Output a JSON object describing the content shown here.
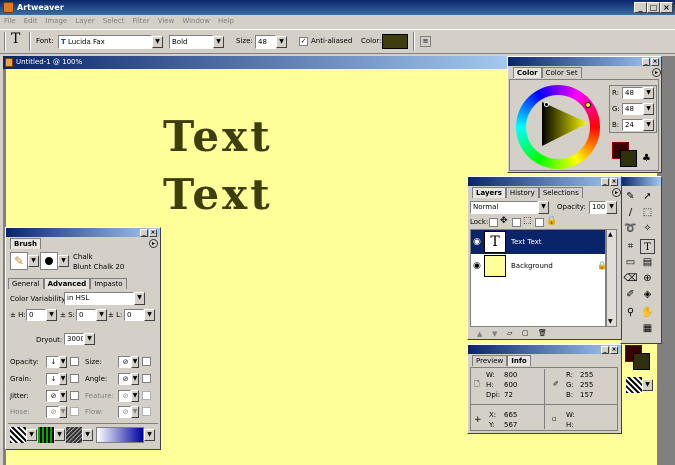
{
  "app": {
    "title": "Artweaver"
  },
  "menu": [
    "File",
    "Edit",
    "Image",
    "Layer",
    "Select",
    "Filter",
    "View",
    "Window",
    "Help"
  ],
  "toolbar": {
    "tool_glyph": "T",
    "font_label": "Font:",
    "font_value": "Lucida Fax",
    "style_value": "Bold",
    "size_label": "Size:",
    "size_value": "48",
    "antialias_label": "Anti-aliased",
    "antialias_checked": true,
    "color_label": "Color:",
    "color_value": "#3d3d0d"
  },
  "document": {
    "title": "Untitled-1 @ 100%",
    "lines": [
      "Text",
      "Text"
    ],
    "background": "#ffff99"
  },
  "color_panel": {
    "tabs": [
      "Color",
      "Color Set"
    ],
    "r_label": "R:",
    "r": "48",
    "g_label": "G:",
    "g": "48",
    "b_label": "B:",
    "b": "24"
  },
  "layers_panel": {
    "tabs": [
      "Layers",
      "History",
      "Selections"
    ],
    "mode": "Normal",
    "opacity_label": "Opacity:",
    "opacity": "100",
    "lock_label": "Lock:",
    "layers": [
      {
        "name": "Text Text",
        "thumb": "T",
        "selected": true
      },
      {
        "name": "Background",
        "thumb": "",
        "selected": false
      }
    ]
  },
  "info_panel": {
    "tabs": [
      "Preview",
      "Info"
    ],
    "w_label": "W:",
    "w": "800",
    "h_label": "H:",
    "h": "600",
    "dpi_label": "Dpi:",
    "dpi": "72",
    "r_label": "R:",
    "r": "255",
    "g_label": "G:",
    "g": "255",
    "b_label": "B:",
    "b": "157",
    "x_label": "X:",
    "x": "665",
    "y_label": "Y:",
    "y": "567",
    "w2_label": "W:",
    "h2_label": "H:"
  },
  "brush_panel": {
    "tab": "Brush",
    "brush_name": "Chalk",
    "brush_variant": "Blunt Chalk 20",
    "subtabs": [
      "General",
      "Advanced",
      "Impasto"
    ],
    "color_variability_label": "Color Variability:",
    "color_variability": "in HSL",
    "h_label": "± H:",
    "h": "0",
    "s_label": "± S:",
    "s": "0",
    "l_label": "± L:",
    "l": "0",
    "dryout_label": "Dryout:",
    "dryout": "3000",
    "rows": [
      {
        "label": "Opacity:",
        "label2": "Size:"
      },
      {
        "label": "Grain:",
        "label2": "Angle:"
      },
      {
        "label": "Jitter:",
        "label2": "Feature:"
      },
      {
        "label": "Hose:",
        "label2": "Flow:"
      }
    ]
  }
}
